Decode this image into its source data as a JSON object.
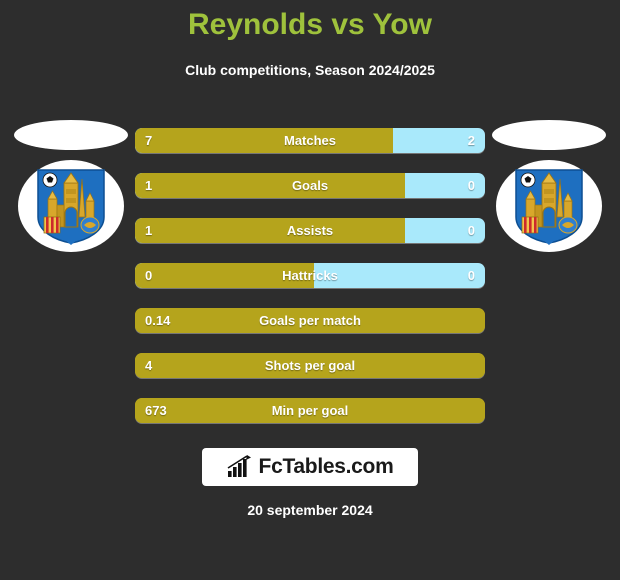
{
  "header": {
    "title": "Reynolds vs Yow",
    "subtitle": "Club competitions, Season 2024/2025",
    "title_color": "#9fc23c"
  },
  "colors": {
    "background": "#2d2d2d",
    "home_bar": "#b5a41c",
    "away_bar": "#a9e9fb",
    "text": "#ffffff"
  },
  "teams": {
    "home": {
      "crest": "club-crest-castle-icon"
    },
    "away": {
      "crest": "club-crest-castle-icon"
    }
  },
  "stats": [
    {
      "label": "Matches",
      "home": "7",
      "away": "2",
      "home_pct": 73.6,
      "two_sided": true
    },
    {
      "label": "Goals",
      "home": "1",
      "away": "0",
      "home_pct": 77.0,
      "two_sided": true
    },
    {
      "label": "Assists",
      "home": "1",
      "away": "0",
      "home_pct": 77.0,
      "two_sided": true
    },
    {
      "label": "Hattricks",
      "home": "0",
      "away": "0",
      "home_pct": 51.0,
      "two_sided": true
    },
    {
      "label": "Goals per match",
      "home": "0.14",
      "away": "",
      "home_pct": 100,
      "two_sided": false
    },
    {
      "label": "Shots per goal",
      "home": "4",
      "away": "",
      "home_pct": 100,
      "two_sided": false
    },
    {
      "label": "Min per goal",
      "home": "673",
      "away": "",
      "home_pct": 100,
      "two_sided": false
    }
  ],
  "logo": {
    "text": "FcTables.com",
    "icon": "bar-chart-growth-icon"
  },
  "footer": {
    "date": "20 september 2024"
  }
}
